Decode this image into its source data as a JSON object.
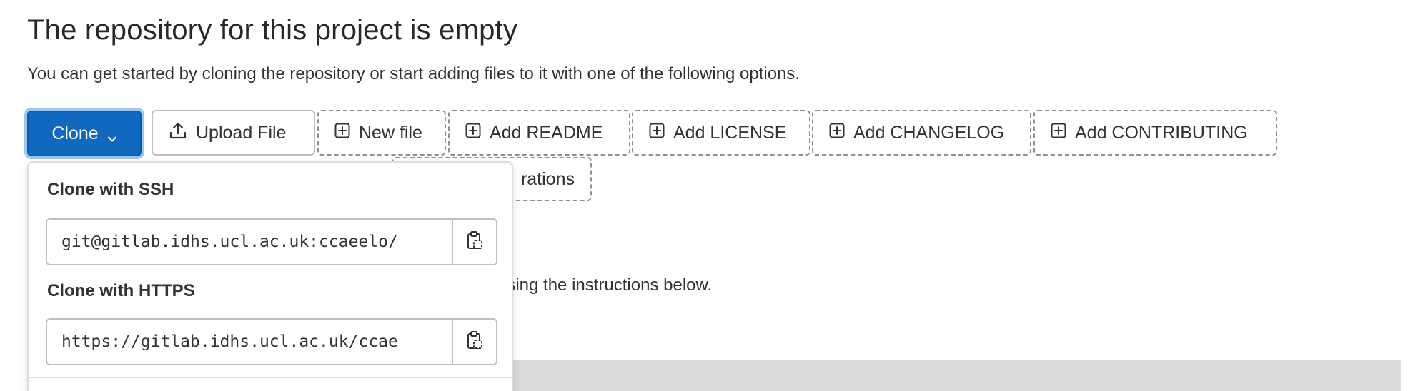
{
  "page": {
    "title": "The repository for this project is empty",
    "subtitle": "You can get started by cloning the repository or start adding files to it with one of the following options."
  },
  "clone_button": {
    "label": "Clone",
    "icon": "chevron-down-icon"
  },
  "actions": [
    {
      "label": "Upload File",
      "icon": "upload-icon"
    },
    {
      "label": "New file",
      "icon": "plus-square-icon"
    },
    {
      "label": "Add README",
      "icon": "plus-square-icon"
    },
    {
      "label": "Add LICENSE",
      "icon": "plus-square-icon"
    },
    {
      "label": "Add CHANGELOG",
      "icon": "plus-square-icon"
    },
    {
      "label": "Add CONTRIBUTING",
      "icon": "plus-square-icon"
    },
    {
      "label": "rations"
    }
  ],
  "dropdown": {
    "ssh": {
      "label": "Clone with SSH",
      "value": "git@gitlab.idhs.ucl.ac.uk:ccaeelo/",
      "copy_icon": "clipboard-icon"
    },
    "https": {
      "label": "Clone with HTTPS",
      "value": "https://gitlab.idhs.ucl.ac.uk/ccae",
      "copy_icon": "clipboard-icon"
    }
  },
  "background": {
    "instructions_fragment": "using the instructions below."
  },
  "colors": {
    "primary": "#1068bf",
    "focus_ring": "#9ec5ee",
    "text": "#333238",
    "border": "#bfbfc3"
  }
}
